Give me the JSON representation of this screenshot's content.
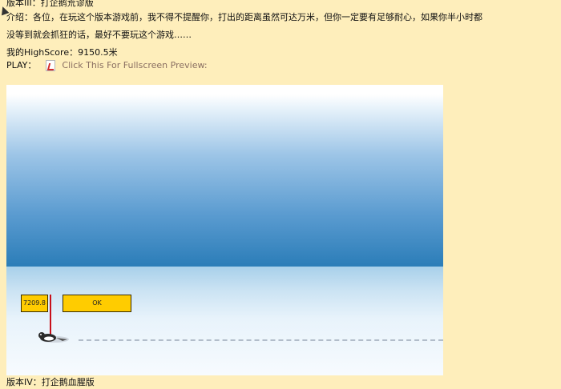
{
  "header": {
    "title": "版本III：打企鹅荒谬版",
    "intro_line1": "介绍：各位，在玩这个版本游戏前，我不得不提醒你，打出的距离虽然可达万米，但你一定要有足够耐心，如果你半小时都",
    "intro_line2": "没等到就会抓狂的话，最好不要玩这个游戏……",
    "highscore": "我的HighScore：9150.5米",
    "play_label": "PLAY：",
    "play_link_text": "Click This For Fullscreen Preview:"
  },
  "game": {
    "distance_readout": "7209.8",
    "ok_button": "OK"
  },
  "footer": {
    "next_version": "版本IV：打企鹅血腥版"
  },
  "colors": {
    "page_bg": "#feeebb",
    "link": "#8a6f62",
    "button_yellow": "#ffcc00",
    "pole_red": "#c8101a"
  }
}
